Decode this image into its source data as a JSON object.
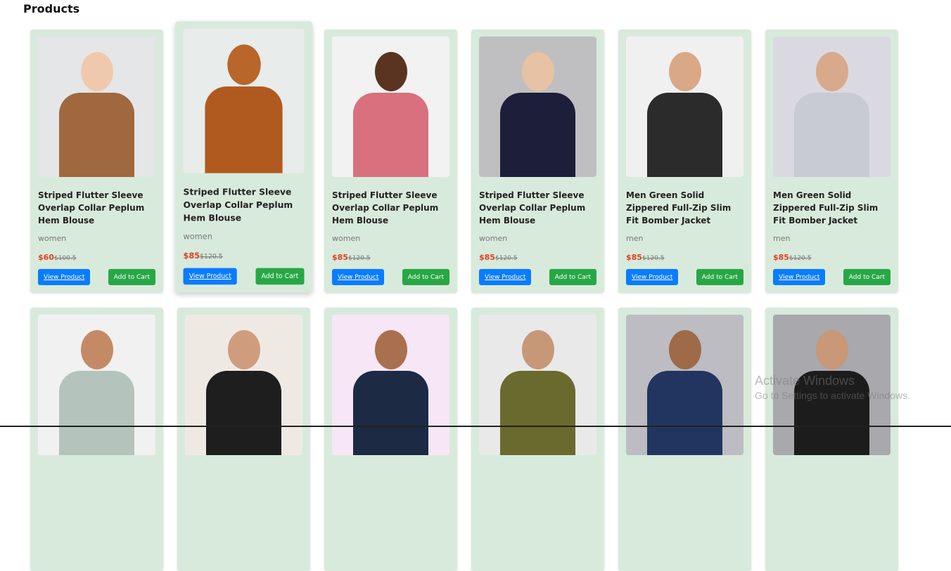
{
  "section_title": "Products",
  "products": [
    {
      "title": "Striped Flutter Sleeve Overlap Collar Peplum Hem Blouse",
      "category": "women",
      "price": "$60",
      "old_price": "$100.5",
      "bg": "#e4e6e8",
      "skin": "#f0c9ad",
      "cloth": "#a0683e"
    },
    {
      "title": "Striped Flutter Sleeve Overlap Collar Peplum Hem Blouse",
      "category": "women",
      "price": "$85",
      "old_price": "$120.5",
      "bg": "#e8ecea",
      "skin": "#b8662a",
      "cloth": "#b05a20"
    },
    {
      "title": "Striped Flutter Sleeve Overlap Collar Peplum Hem Blouse",
      "category": "women",
      "price": "$85",
      "old_price": "$120.5",
      "bg": "#f2f2f2",
      "skin": "#5a3420",
      "cloth": "#d9707e"
    },
    {
      "title": "Striped Flutter Sleeve Overlap Collar Peplum Hem Blouse",
      "category": "women",
      "price": "$85",
      "old_price": "$120.5",
      "bg": "#bfbfc1",
      "skin": "#e8c2a4",
      "cloth": "#1c1e3a"
    },
    {
      "title": "Men Green Solid Zippered Full-Zip Slim Fit Bomber Jacket",
      "category": "men",
      "price": "$85",
      "old_price": "$120.5",
      "bg": "#f0f0f0",
      "skin": "#d9a887",
      "cloth": "#2b2b2b"
    },
    {
      "title": "Men Green Solid Zippered Full-Zip Slim Fit Bomber Jacket",
      "category": "men",
      "price": "$85",
      "old_price": "$120.5",
      "bg": "#dad9e2",
      "skin": "#d8a98a",
      "cloth": "#c9cbd2"
    },
    {
      "title": "",
      "category": "",
      "price": "",
      "old_price": "",
      "bg": "#f1f1f1",
      "skin": "#c48a66",
      "cloth": "#b4c4bc"
    },
    {
      "title": "",
      "category": "",
      "price": "",
      "old_price": "",
      "bg": "#efe9e4",
      "skin": "#cf9d7e",
      "cloth": "#1e1e1e"
    },
    {
      "title": "",
      "category": "",
      "price": "",
      "old_price": "",
      "bg": "#f6e6f6",
      "skin": "#a8704e",
      "cloth": "#1d2a44"
    },
    {
      "title": "",
      "category": "",
      "price": "",
      "old_price": "",
      "bg": "#e9e9e9",
      "skin": "#c79878",
      "cloth": "#6b6a2e"
    },
    {
      "title": "",
      "category": "",
      "price": "",
      "old_price": "",
      "bg": "#bcbcc2",
      "skin": "#9e6a48",
      "cloth": "#223560"
    },
    {
      "title": "",
      "category": "",
      "price": "",
      "old_price": "",
      "bg": "#a8a8ad",
      "skin": "#c89878",
      "cloth": "#1c1c1c"
    }
  ],
  "buttons": {
    "view": "View Product",
    "cart": "Add to Cart"
  },
  "watermark": {
    "line1": "Activate Windows",
    "line2": "Go to Settings to activate Windows."
  }
}
